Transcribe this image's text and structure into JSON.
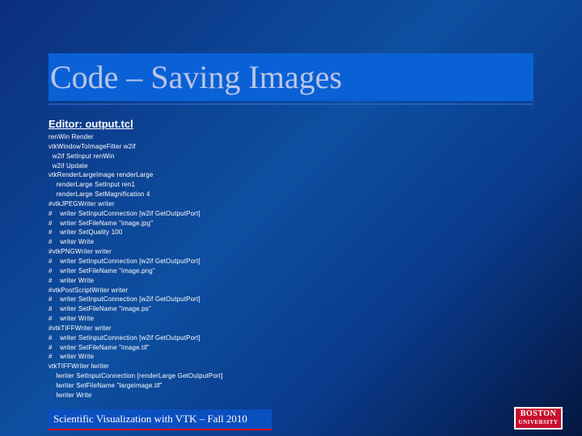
{
  "slide": {
    "title": "Code – Saving Images",
    "editor_label": "Editor: output.tcl",
    "code_lines": [
      "renWin Render",
      "vtkWindowToImageFilter w2if",
      "  w2if SetInput renWin",
      "  w2if Update",
      "vtkRenderLargeImage renderLarge",
      "    renderLarge SetInput ren1",
      "    renderLarge SetMagnification 4",
      "#vtkJPEGWriter writer",
      "#    writer SetInputConnection [w2if GetOutputPort]",
      "#    writer SetFileName \"image.jpg\"",
      "#    writer SetQuality 100",
      "#    writer Write",
      "#vtkPNGWriter writer",
      "#    writer SetInputConnection [w2if GetOutputPort]",
      "#    writer SetFileName \"image.png\"",
      "#    writer Write",
      "#vtkPostScriptWriter writer",
      "#    writer SetInputConnection [w2if GetOutputPort]",
      "#    writer SetFileName \"image.ps\"",
      "#    writer Write",
      "#vtkTIFFWriter writer",
      "#    writer SetInputConnection [w2if GetOutputPort]",
      "#    writer SetFileName \"image.tif\"",
      "#    writer Write",
      "vtkTIFFWriter lwriter",
      "    lwriter SetInputConnection [renderLarge GetOutputPort]",
      "    lwriter SetFileName \"largeimage.tif\"",
      "    lwriter Write"
    ],
    "footer": "Scientific Visualization with VTK – Fall 2010",
    "logo": {
      "line1": "BOSTON",
      "line2": "UNIVERSITY"
    }
  },
  "colors": {
    "title_bar": "#0a61d6",
    "title_text": "#b9c6e8",
    "footer_underline": "#d90000",
    "logo_bg": "#c8102e"
  }
}
